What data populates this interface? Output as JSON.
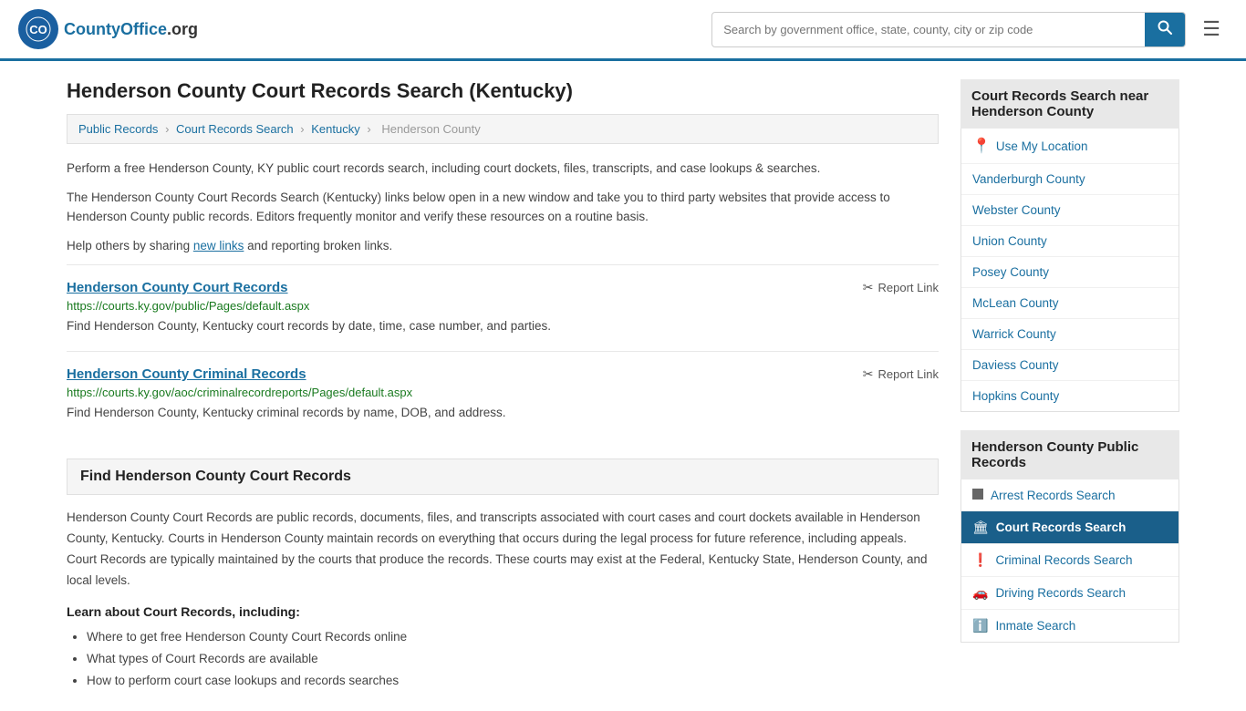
{
  "header": {
    "logo_text": "CountyOffice",
    "logo_tld": ".org",
    "search_placeholder": "Search by government office, state, county, city or zip code",
    "search_value": ""
  },
  "page": {
    "title": "Henderson County Court Records Search (Kentucky)",
    "breadcrumbs": [
      {
        "label": "Public Records",
        "href": "#"
      },
      {
        "label": "Court Records Search",
        "href": "#"
      },
      {
        "label": "Kentucky",
        "href": "#"
      },
      {
        "label": "Henderson County",
        "href": "#"
      }
    ],
    "description1": "Perform a free Henderson County, KY public court records search, including court dockets, files, transcripts, and case lookups & searches.",
    "description2": "The Henderson County Court Records Search (Kentucky) links below open in a new window and take you to third party websites that provide access to Henderson County public records. Editors frequently monitor and verify these resources on a routine basis.",
    "description3_pre": "Help others by sharing ",
    "description3_link": "new links",
    "description3_post": " and reporting broken links.",
    "records": [
      {
        "title": "Henderson County Court Records",
        "url": "https://courts.ky.gov/public/Pages/default.aspx",
        "desc": "Find Henderson County, Kentucky court records by date, time, case number, and parties.",
        "report_label": "Report Link"
      },
      {
        "title": "Henderson County Criminal Records",
        "url": "https://courts.ky.gov/aoc/criminalrecordreports/Pages/default.aspx",
        "desc": "Find Henderson County, Kentucky criminal records by name, DOB, and address.",
        "report_label": "Report Link"
      }
    ],
    "find_section_title": "Find Henderson County Court Records",
    "find_body": "Henderson County Court Records are public records, documents, files, and transcripts associated with court cases and court dockets available in Henderson County, Kentucky. Courts in Henderson County maintain records on everything that occurs during the legal process for future reference, including appeals. Court Records are typically maintained by the courts that produce the records. These courts may exist at the Federal, Kentucky State, Henderson County, and local levels.",
    "learn_heading": "Learn about Court Records, including:",
    "learn_bullets": [
      "Where to get free Henderson County Court Records online",
      "What types of Court Records are available",
      "How to perform court case lookups and records searches"
    ]
  },
  "sidebar": {
    "nearby_title": "Court Records Search near Henderson County",
    "nearby_items": [
      {
        "label": "Use My Location",
        "href": "#",
        "type": "location"
      },
      {
        "label": "Vanderburgh County",
        "href": "#"
      },
      {
        "label": "Webster County",
        "href": "#"
      },
      {
        "label": "Union County",
        "href": "#"
      },
      {
        "label": "Posey County",
        "href": "#"
      },
      {
        "label": "McLean County",
        "href": "#"
      },
      {
        "label": "Warrick County",
        "href": "#"
      },
      {
        "label": "Daviess County",
        "href": "#"
      },
      {
        "label": "Hopkins County",
        "href": "#"
      }
    ],
    "public_records_title": "Henderson County Public Records",
    "public_records_items": [
      {
        "label": "Arrest Records Search",
        "icon": "■",
        "active": false
      },
      {
        "label": "Court Records Search",
        "icon": "🏛",
        "active": true
      },
      {
        "label": "Criminal Records Search",
        "icon": "!",
        "active": false
      },
      {
        "label": "Driving Records Search",
        "icon": "🚗",
        "active": false
      },
      {
        "label": "Inmate Search",
        "icon": "ℹ",
        "active": false
      }
    ]
  }
}
